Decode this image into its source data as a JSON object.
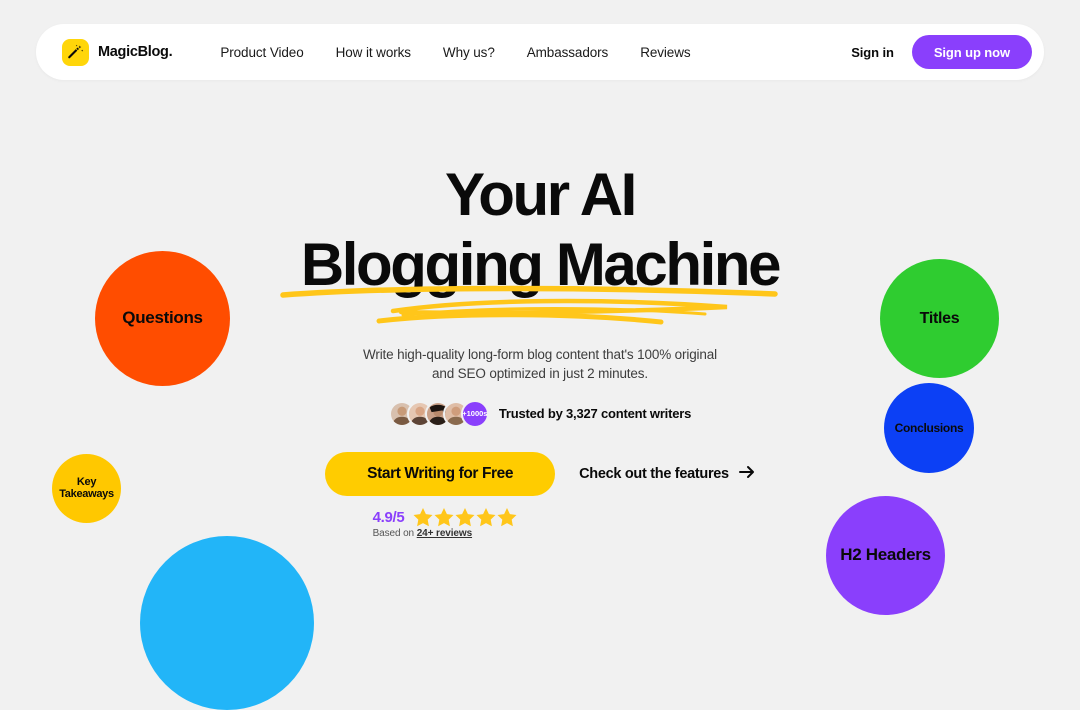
{
  "brand": {
    "name": "MagicBlog.",
    "icon": "magic-wand-icon",
    "mark_color": "#ffd60a"
  },
  "nav": {
    "links": [
      {
        "label": "Product Video"
      },
      {
        "label": "How it works"
      },
      {
        "label": "Why us?"
      },
      {
        "label": "Ambassadors"
      },
      {
        "label": "Reviews"
      }
    ],
    "signin_label": "Sign in",
    "signup_label": "Sign up now",
    "signup_color": "#8a3ffc"
  },
  "hero": {
    "headline_line1": "Your AI",
    "headline_line2": "Blogging Machine",
    "underline_color": "#ffc61a",
    "subtitle_line1": "Write high-quality long-form blog content that's 100% original",
    "subtitle_line2": "and SEO optimized in just 2 minutes.",
    "avatar_more_label": "+1000s",
    "trust_text": "Trusted by 3,327 content writers",
    "cta_primary_label": "Start Writing for Free",
    "cta_primary_color": "#ffcc00",
    "cta_secondary_label": "Check out the features",
    "cta_secondary_icon": "arrow-right-icon"
  },
  "rating": {
    "score": "4.9/5",
    "score_color": "#8a3ffc",
    "stars_filled": 5,
    "star_color": "#ffc61a",
    "based_on_prefix": "Based on ",
    "reviews_link": "24+ reviews"
  },
  "circles": [
    {
      "id": "questions",
      "label": "Questions",
      "color": "#ff4d00"
    },
    {
      "id": "keytake",
      "label": "Key\nTakeaways",
      "label_line1": "Key",
      "label_line2": "Takeaways",
      "color": "#ffc800"
    },
    {
      "id": "cyan",
      "label": "",
      "color": "#22b5f8"
    },
    {
      "id": "titles",
      "label": "Titles",
      "color": "#2fcc30"
    },
    {
      "id": "conclusions",
      "label": "Conclusions",
      "color": "#0c40f5"
    },
    {
      "id": "h2headers",
      "label": "H2 Headers",
      "color": "#8a3ffc"
    }
  ],
  "page": {
    "background": "#f1f1f1"
  }
}
